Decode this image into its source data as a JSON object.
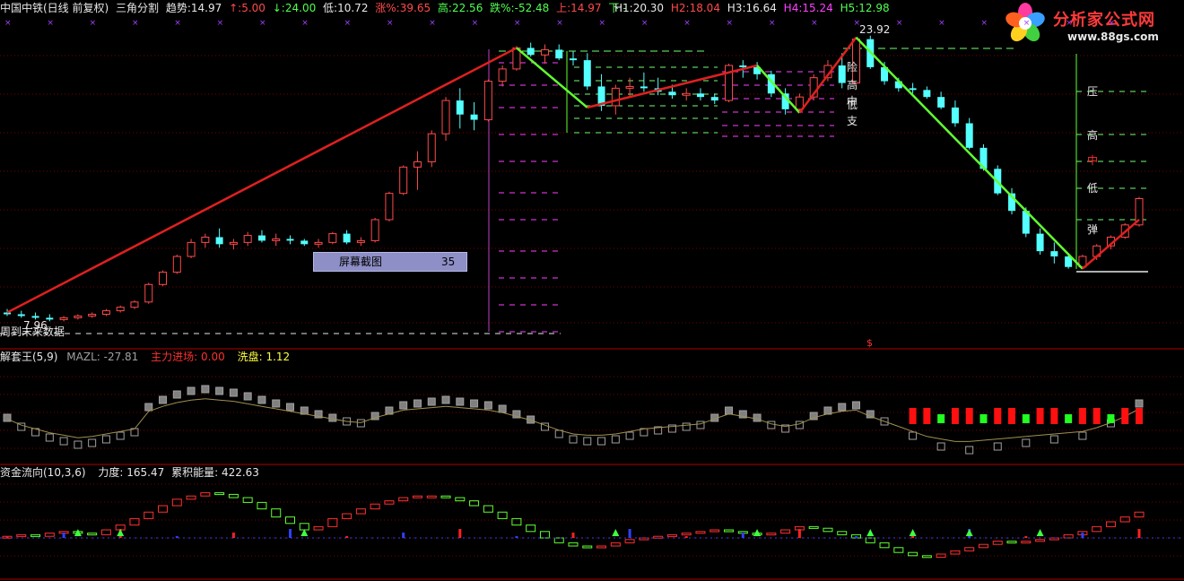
{
  "header": {
    "name": "中国中铁(日线 前复权)",
    "formula": "三角分割",
    "trend_label": "趋势:",
    "trend_value": "14.97",
    "up_label": "↑:",
    "up_value": "5.00",
    "down_label": "↓:",
    "down_value": "24.00",
    "low_label": "低:",
    "low_value": "10.72",
    "rise_label": "涨%:",
    "rise_value": "39.65",
    "high_label": "高:",
    "high_value": "22.56",
    "fall_label": "跌%:",
    "fall_value": "-52.48",
    "upper_label": "上:",
    "upper_value": "14.97",
    "lower_label": "下:",
    "lower_value": "-",
    "h1_label": "H1:",
    "h1_value": "20.30",
    "h2_label": "H2:",
    "h2_value": "18.04",
    "h3_label": "H3:",
    "h3_value": "16.64",
    "h4_label": "H4:",
    "h4_value": "15.24",
    "h5_label": "H5:",
    "h5_value": "12.98"
  },
  "logo": {
    "title": "分析家公式网",
    "url": "www.88gs.com"
  },
  "main": {
    "peak_label": "23.92",
    "low_price_label": "7.96",
    "status_text": "周到末来数据",
    "markers_mid": [
      "险",
      "高",
      "中",
      "低",
      "支"
    ],
    "markers_right": [
      "压",
      "高",
      "中",
      "低",
      "弹"
    ],
    "dollar_mark": "$"
  },
  "dock": {
    "title": "屏幕截图",
    "count": "35"
  },
  "panel2": {
    "name": "解套王(5,9)",
    "mazl_label": "MAZL:",
    "mazl_value": "-27.81",
    "zl_label": "主力进场:",
    "zl_value": "0.00",
    "xp_label": "洗盘:",
    "xp_value": "1.12"
  },
  "panel3": {
    "name": "资金流向(10,3,6)",
    "force_label": "力度:",
    "force_value": "165.47",
    "energy_label": "累积能量:",
    "energy_value": "422.63"
  },
  "colors": {
    "background": "#000000",
    "up": "#ff4a4a",
    "down": "#54ffff",
    "ma_line": "#e02020",
    "trend_down": "#60ff30",
    "magenta": "#ff40ff",
    "grid": "#7a0000",
    "label_white": "#e8e8e8",
    "yellow": "#ffff00"
  },
  "chart_data": {
    "type": "candlestick",
    "ohlc": [
      [
        8.2,
        8.4,
        8.0,
        8.1
      ],
      [
        8.1,
        8.3,
        7.9,
        8.0
      ],
      [
        8.0,
        8.2,
        7.8,
        7.9
      ],
      [
        7.9,
        8.1,
        7.7,
        7.8
      ],
      [
        7.8,
        8.0,
        7.7,
        7.9
      ],
      [
        7.9,
        8.1,
        7.8,
        8.0
      ],
      [
        8.0,
        8.2,
        7.9,
        8.1
      ],
      [
        8.1,
        8.4,
        8.0,
        8.3
      ],
      [
        8.3,
        8.6,
        8.2,
        8.5
      ],
      [
        8.5,
        8.9,
        8.4,
        8.8
      ],
      [
        8.8,
        9.9,
        8.7,
        9.8
      ],
      [
        9.8,
        10.6,
        9.7,
        10.5
      ],
      [
        10.5,
        11.5,
        10.4,
        11.4
      ],
      [
        11.4,
        12.4,
        11.3,
        12.2
      ],
      [
        12.2,
        12.7,
        11.9,
        12.5
      ],
      [
        12.5,
        13.0,
        11.9,
        12.1
      ],
      [
        12.1,
        12.4,
        11.8,
        12.2
      ],
      [
        12.2,
        12.8,
        12.0,
        12.6
      ],
      [
        12.6,
        12.9,
        12.2,
        12.3
      ],
      [
        12.3,
        12.7,
        12.0,
        12.4
      ],
      [
        12.4,
        12.6,
        12.1,
        12.3
      ],
      [
        12.3,
        12.4,
        12.0,
        12.1
      ],
      [
        12.1,
        12.4,
        11.9,
        12.2
      ],
      [
        12.2,
        12.8,
        12.1,
        12.7
      ],
      [
        12.7,
        12.9,
        12.1,
        12.2
      ],
      [
        12.2,
        12.5,
        12.0,
        12.3
      ],
      [
        12.3,
        13.6,
        12.2,
        13.5
      ],
      [
        13.5,
        15.1,
        13.4,
        15.0
      ],
      [
        15.0,
        16.6,
        14.9,
        16.5
      ],
      [
        16.5,
        17.4,
        15.2,
        16.8
      ],
      [
        16.8,
        18.6,
        16.5,
        18.4
      ],
      [
        18.4,
        20.5,
        18.0,
        20.3
      ],
      [
        20.3,
        21.0,
        18.7,
        19.5
      ],
      [
        19.5,
        20.2,
        18.6,
        19.2
      ],
      [
        19.2,
        21.5,
        19.1,
        21.4
      ],
      [
        21.4,
        22.3,
        21.1,
        22.1
      ],
      [
        22.1,
        23.4,
        22.0,
        23.3
      ],
      [
        23.3,
        23.6,
        22.8,
        22.9
      ],
      [
        22.9,
        23.5,
        22.4,
        23.2
      ],
      [
        23.2,
        23.5,
        22.6,
        22.7
      ],
      [
        22.7,
        23.1,
        22.3,
        22.6
      ],
      [
        22.6,
        23.0,
        20.9,
        21.1
      ],
      [
        21.1,
        21.8,
        19.7,
        20.0
      ],
      [
        20.0,
        21.2,
        19.5,
        21.0
      ],
      [
        21.0,
        21.6,
        20.5,
        21.1
      ],
      [
        21.1,
        21.9,
        20.8,
        21.0
      ],
      [
        21.0,
        21.6,
        20.6,
        20.8
      ],
      [
        20.8,
        21.2,
        20.4,
        20.6
      ],
      [
        20.6,
        21.0,
        20.3,
        20.7
      ],
      [
        20.7,
        21.0,
        20.3,
        20.5
      ],
      [
        20.5,
        20.7,
        20.1,
        20.3
      ],
      [
        20.3,
        22.4,
        20.2,
        22.3
      ],
      [
        22.3,
        22.6,
        21.6,
        22.2
      ],
      [
        22.2,
        22.5,
        21.5,
        21.8
      ],
      [
        21.8,
        22.0,
        20.5,
        20.7
      ],
      [
        20.7,
        21.0,
        19.5,
        19.8
      ],
      [
        19.8,
        20.7,
        19.6,
        20.5
      ],
      [
        20.5,
        21.8,
        20.3,
        21.6
      ],
      [
        21.6,
        22.6,
        21.4,
        22.3
      ],
      [
        22.3,
        23.0,
        21.0,
        21.3
      ],
      [
        21.3,
        23.9,
        21.2,
        23.8
      ],
      [
        23.8,
        24.0,
        22.1,
        22.2
      ],
      [
        22.2,
        22.5,
        21.2,
        21.4
      ],
      [
        21.4,
        21.6,
        20.8,
        21.0
      ],
      [
        21.0,
        21.3,
        20.7,
        20.9
      ],
      [
        20.9,
        21.1,
        20.4,
        20.5
      ],
      [
        20.5,
        20.8,
        19.8,
        19.9
      ],
      [
        19.9,
        20.3,
        18.8,
        19.0
      ],
      [
        19.0,
        19.3,
        17.5,
        17.6
      ],
      [
        17.6,
        17.8,
        16.3,
        16.4
      ],
      [
        16.4,
        16.6,
        14.9,
        15.0
      ],
      [
        15.0,
        15.3,
        13.8,
        14.0
      ],
      [
        14.0,
        14.2,
        12.5,
        12.7
      ],
      [
        12.7,
        13.0,
        11.5,
        11.7
      ],
      [
        11.7,
        12.2,
        11.0,
        11.4
      ],
      [
        11.4,
        11.6,
        10.7,
        10.8
      ],
      [
        10.8,
        11.5,
        10.7,
        11.4
      ],
      [
        11.4,
        12.1,
        11.2,
        12.0
      ],
      [
        12.0,
        12.6,
        11.8,
        12.5
      ],
      [
        12.5,
        13.3,
        12.4,
        13.2
      ],
      [
        13.2,
        14.8,
        13.1,
        14.7
      ]
    ],
    "trend_line_points": [
      8.0,
      23.3,
      19.9,
      22.3,
      19.6,
      23.9,
      10.7,
      13.5
    ],
    "xlabel": "",
    "ylabel": "",
    "panel2_bars": [
      0.2,
      -0.3,
      -0.6,
      -0.9,
      -1.1,
      -1.3,
      -1.2,
      -1.0,
      -0.8,
      -0.6,
      0.8,
      1.2,
      1.5,
      1.7,
      1.8,
      1.7,
      1.6,
      1.4,
      1.2,
      1.0,
      0.8,
      0.6,
      0.4,
      0.2,
      0.0,
      -0.1,
      0.3,
      0.6,
      0.9,
      1.0,
      1.1,
      1.2,
      1.1,
      1.0,
      0.9,
      0.7,
      0.4,
      0.1,
      -0.3,
      -0.7,
      -1.0,
      -1.1,
      -1.1,
      -1.0,
      -0.8,
      -0.6,
      -0.5,
      -0.4,
      -0.3,
      -0.2,
      0.2,
      0.6,
      0.4,
      0.2,
      -0.2,
      -0.4,
      -0.2,
      0.3,
      0.6,
      0.8,
      0.9,
      0.4,
      0.0,
      -0.4,
      -0.8,
      -1.2,
      -1.4,
      -1.6,
      -1.6,
      -1.5,
      -1.4,
      -1.3,
      -1.2,
      -1.1,
      -1.0,
      -0.9,
      -0.8,
      -0.5,
      -0.1,
      0.4,
      1.0
    ],
    "panel3_bars": [
      0.1,
      0.2,
      0.1,
      0.3,
      0.4,
      0.3,
      0.2,
      0.5,
      0.8,
      1.2,
      1.6,
      2.0,
      2.4,
      2.6,
      2.8,
      2.7,
      2.5,
      2.2,
      1.8,
      1.3,
      0.9,
      0.5,
      0.7,
      1.2,
      1.5,
      1.8,
      2.1,
      2.3,
      2.5,
      2.6,
      2.6,
      2.5,
      2.3,
      2.0,
      1.6,
      1.2,
      0.8,
      0.4,
      0.0,
      -0.3,
      -0.5,
      -0.6,
      -0.5,
      -0.3,
      -0.1,
      0.0,
      0.1,
      0.2,
      0.3,
      0.4,
      0.5,
      0.4,
      0.3,
      0.2,
      0.3,
      0.5,
      0.7,
      0.6,
      0.4,
      0.2,
      0.0,
      -0.3,
      -0.6,
      -0.9,
      -1.1,
      -1.2,
      -1.0,
      -0.8,
      -0.6,
      -0.4,
      -0.2,
      -0.3,
      -0.2,
      -0.1,
      0.0,
      0.2,
      0.4,
      0.7,
      1.0,
      1.3,
      1.6
    ]
  }
}
